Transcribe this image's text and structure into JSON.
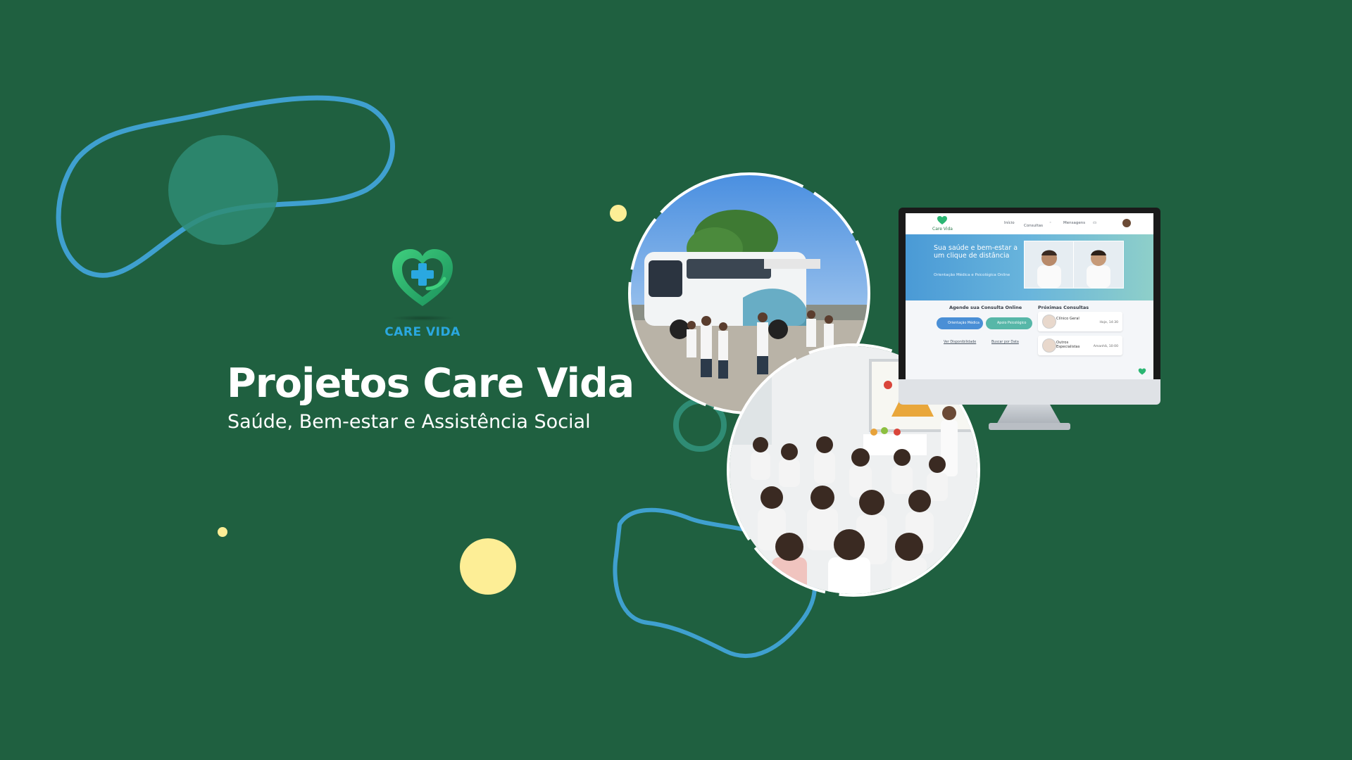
{
  "brand": {
    "logo_text": "CARE VIDA",
    "accent_blue": "#2aa8e0",
    "accent_green": "#2bb673",
    "background": "#1f6040"
  },
  "hero": {
    "title": "Projetos Care Vida",
    "subtitle": "Saúde, Bem-estar e Assistência Social"
  },
  "photos": {
    "bus": {
      "description_icon": "mobile-clinic-bus-photo"
    },
    "class": {
      "description_icon": "nutrition-class-photo"
    }
  },
  "monitor_app": {
    "brand": "Care Vida",
    "nav": [
      "Início",
      "Consultas",
      "Mensagens"
    ],
    "hero_title": "Sua saúde e bem-estar a um clique de distância",
    "hero_sub": "Orientação Médica e Psicológica Online",
    "schedule_title": "Agende sua Consulta Online",
    "buttons": [
      "Orientação Médica",
      "Apoio Psicológico"
    ],
    "links": [
      "Ver Disponibilidade",
      "Buscar por Data"
    ],
    "upcoming_title": "Próximas Consultas",
    "appointments": [
      {
        "name": "Clínico Geral",
        "time": "Hoje, 14:30"
      },
      {
        "name": "Outros Especialistas",
        "time": "Amanhã, 10:00"
      }
    ]
  }
}
